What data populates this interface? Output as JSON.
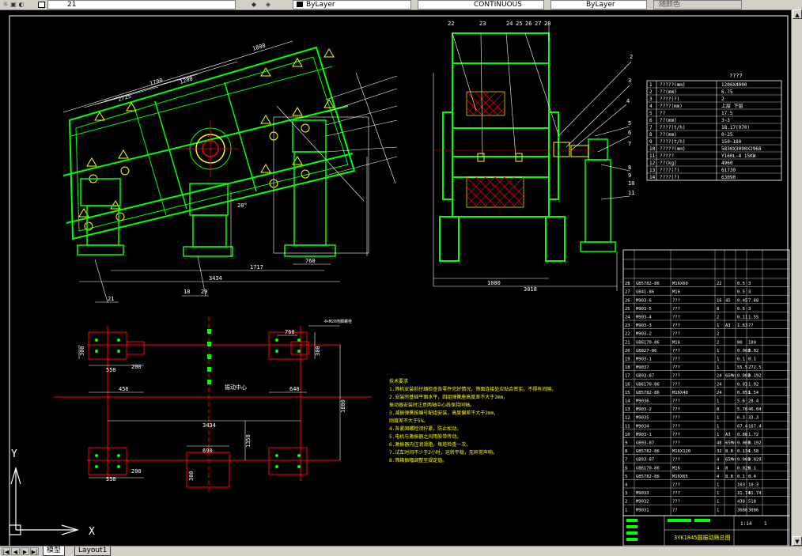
{
  "toolbar": {
    "layer_name": "21",
    "color": "ByLayer",
    "linetype": "CONTINUOUS",
    "lineweight": "ByLayer",
    "plotstyle": "随颜色"
  },
  "drawing": {
    "title": "3YK1845圆振动筛总图",
    "params_title": "????",
    "params": [
      [
        "1",
        "?????(mm)",
        "1200X4000"
      ],
      [
        "2",
        "??(mm)",
        "6.75"
      ],
      [
        "3",
        "????(?)",
        "2"
      ],
      [
        "4",
        "????(mm)",
        "上层 下层"
      ],
      [
        "5",
        "??",
        "17.5"
      ],
      [
        "6",
        "??(mm)",
        "3~3"
      ],
      [
        "7",
        "????(t/h)",
        "18.17(970)"
      ],
      [
        "8",
        "??(mm)",
        "0~25"
      ],
      [
        "9",
        "????(t/h)",
        "150~180"
      ],
      [
        "10",
        "?????(mm)",
        "5830X3090X2968"
      ],
      [
        "11",
        "?????",
        "Y160L-4 15KW"
      ],
      [
        "12",
        "??(kg)",
        "4960"
      ],
      [
        "13",
        "????(?)",
        "61730"
      ],
      [
        "14",
        "????(?)",
        "63090"
      ]
    ],
    "bom": [
      [
        "28",
        "GB5782-86",
        "M16X60",
        "22",
        "",
        "0.5",
        "3"
      ],
      [
        "27",
        "GB41-86",
        "M16",
        "",
        "",
        "0.5",
        "3"
      ],
      [
        "26",
        "M903-6",
        "???",
        "16",
        "45",
        "0.45",
        "7.68"
      ],
      [
        "25",
        "M903-5",
        "???",
        "8",
        "",
        "0.6",
        "3"
      ],
      [
        "24",
        "M903-4",
        "???",
        "2",
        "",
        "0.11",
        "1.55"
      ],
      [
        "23",
        "M903-3",
        "???",
        "1",
        "A3",
        "1.63",
        "??"
      ],
      [
        "22",
        "M903-2",
        "???",
        "2",
        "",
        "",
        ""
      ],
      [
        "21",
        "GB6170-86",
        "M16",
        "2",
        "",
        "80",
        "180"
      ],
      [
        "20",
        "GB827-86",
        "???",
        "1",
        "",
        "0.003",
        "0.02"
      ],
      [
        "19",
        "M903-1",
        "???",
        "1",
        "",
        "0.1",
        "0.1"
      ],
      [
        "18",
        "M9037",
        "???",
        "1",
        "",
        "55.5",
        "272.5"
      ],
      [
        "17",
        "GB93-87",
        "???",
        "24",
        "65Mn",
        "0.003",
        "0.192"
      ],
      [
        "16",
        "GB6170-86",
        "???",
        "24",
        "",
        "0.03",
        "1.92"
      ],
      [
        "15",
        "GB5782-86",
        "M16X40",
        "24",
        "",
        "0.051",
        "1.54"
      ],
      [
        "14",
        "M9036",
        "???",
        "1",
        "",
        "5.6",
        "28.4"
      ],
      [
        "13",
        "M903-2",
        "???",
        "8",
        "",
        "5.78",
        "46.04"
      ],
      [
        "12",
        "M9035",
        "???",
        "1",
        "",
        "6.3",
        "33.3"
      ],
      [
        "11",
        "M9034",
        "???",
        "1",
        "",
        "67.4",
        "167.4"
      ],
      [
        "10",
        "M903-1",
        "???",
        "1",
        "A3",
        "0.88",
        "1.72"
      ],
      [
        "9",
        "GB93-87",
        "???",
        "48",
        "65Mn",
        "0.003",
        "0.192"
      ],
      [
        "8",
        "GB5782-86",
        "M16X120",
        "32",
        "8.8",
        "0.134",
        "1.58"
      ],
      [
        "7",
        "GB93-87",
        "???",
        "4",
        "65Mn",
        "0.003",
        "0.029"
      ],
      [
        "6",
        "GB6170-86",
        "M16",
        "4",
        "8",
        "0.025",
        "0.1"
      ],
      [
        "5",
        "GB5782-86",
        "M16X65",
        "4",
        "8.8",
        "0.1",
        "0.4"
      ],
      [
        "4",
        "",
        "???",
        "1",
        "",
        "103",
        "10.3"
      ],
      [
        "3",
        "M9033",
        "???",
        "1",
        "",
        "31.74",
        "31.74"
      ],
      [
        "2",
        "M9032",
        "???",
        "1",
        "",
        "438",
        "518"
      ],
      [
        "1",
        "M9031",
        "??",
        "1",
        "",
        "3086",
        "3086"
      ]
    ],
    "notes_title": "技术要求",
    "notes": [
      "1.筛机安装前仔细检查各零件完好情况，筛面连接处应贴合密实，不得有间隙。",
      "2.安装时基础平面水平，四组弹簧座高度差不大于2mm，",
      "  振动器安装时注意两轴中心线保持同轴。",
      "3.减振弹簧按编号配组安装，高度偏差不大于2mm，",
      "  刚度差不大于5%。",
      "4.各紧固螺栓须拧紧，防止松动。",
      "5.电机与激振器之间用胶带传动。",
      "6.激振器内注润滑脂，每班检查一次。",
      "7.试车时间不少于2小时，运转平稳，无异常声响。",
      "8.筛箱振幅调整至规定值。"
    ],
    "labels": {
      "dim_1800": "1800",
      "dim_1700": "1700",
      "dim_1200": "1200",
      "dim_2725": "2725",
      "dim_1717": "1717",
      "dim_760": "760",
      "dim_3434": "3434",
      "dim_1080": "1080",
      "dim_3018": "3018",
      "dim_550": "550",
      "dim_200": "200",
      "dim_456": "456",
      "dim_640": "640",
      "dim_690": "690",
      "dim_1800v": "1800",
      "dim_1358": "1358",
      "dim_300": "300",
      "center_label": "振动中心",
      "angle": "20°",
      "scale": "1:14",
      "sheet": "1",
      "anchor": "4×M20地脚螺栓"
    },
    "part_numbers_front": [
      "21",
      "18",
      "20"
    ],
    "part_numbers_side": [
      "22",
      "23",
      "24",
      "25",
      "26",
      "27",
      "28"
    ],
    "part_numbers_right": [
      "2",
      "3",
      "4",
      "5",
      "6",
      "7",
      "8",
      "9",
      "10",
      "11"
    ]
  },
  "status": {
    "model_tab": "模型",
    "layout_tab": "Layout1",
    "ucs_x": "X",
    "ucs_y": "Y"
  }
}
